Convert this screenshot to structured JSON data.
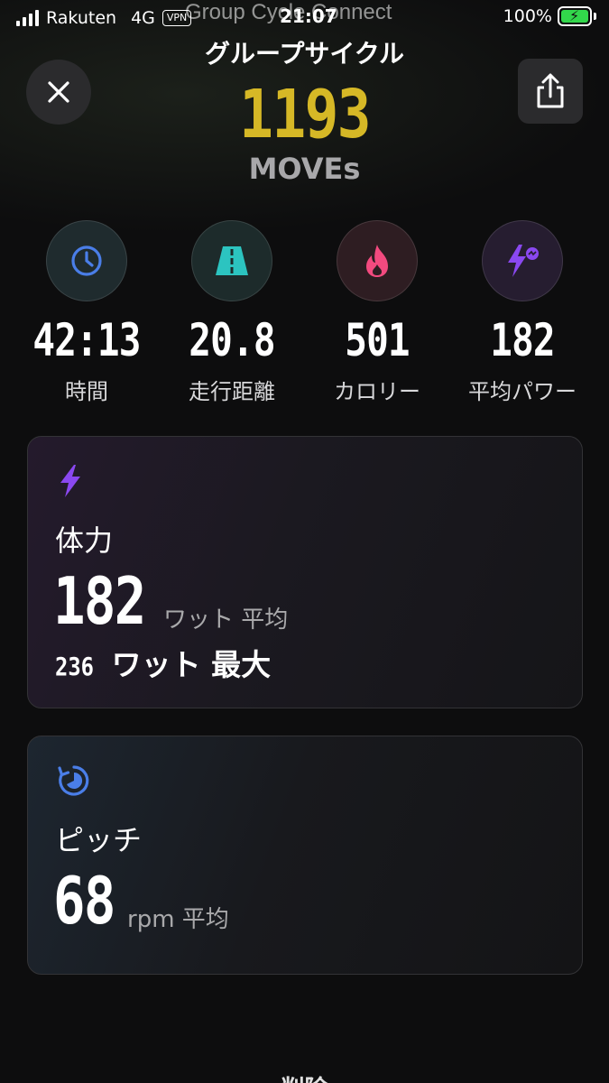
{
  "status_bar": {
    "carrier": "Rakuten",
    "network": "4G",
    "vpn": "VPN",
    "time": "21:07",
    "battery": "100%",
    "overlay_app": "Group Cycle Connect"
  },
  "header": {
    "title": "グループサイクル",
    "moves_value": "1193",
    "moves_label": "MOVEs"
  },
  "stats": [
    {
      "icon": "clock-icon",
      "value": "42:13",
      "label": "時間",
      "color": "#4a7ee8",
      "bg": "#1f2b2e"
    },
    {
      "icon": "road-icon",
      "value": "20.8",
      "label": "走行距離",
      "color": "#2cc4c0",
      "bg": "#1d2b2b"
    },
    {
      "icon": "flame-icon",
      "value": "501",
      "label": "カロリー",
      "color": "#f24a7f",
      "bg": "#2e1d22"
    },
    {
      "icon": "lightning-icon",
      "value": "182",
      "label": "平均パワー",
      "color": "#8a48f0",
      "bg": "#261d30"
    }
  ],
  "power_card": {
    "title": "体力",
    "avg_value": "182",
    "avg_unit": "ワット 平均",
    "max_value": "236",
    "max_label": "ワット 最大",
    "accent": "#8a48f0"
  },
  "pitch_card": {
    "title": "ピッチ",
    "avg_value": "68",
    "avg_unit": "rpm 平均",
    "accent": "#4a7ee8"
  },
  "footer": {
    "delete_label": "削除"
  }
}
